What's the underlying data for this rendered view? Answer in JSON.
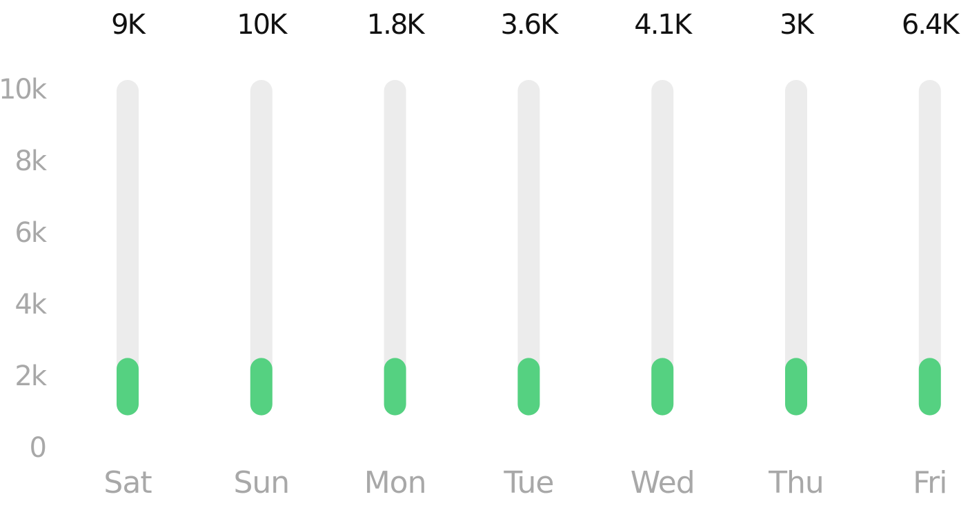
{
  "chart_data": {
    "type": "bar",
    "title": "",
    "xlabel": "",
    "ylabel": "",
    "categories": [
      "Sat",
      "Sun",
      "Mon",
      "Tue",
      "Wed",
      "Thu",
      "Fri"
    ],
    "value_labels": [
      "9K",
      "10K",
      "1.8K",
      "3.6K",
      "4.1K",
      "3K",
      "6.4K"
    ],
    "values": [
      9000,
      10000,
      1800,
      3600,
      4100,
      3000,
      6400
    ],
    "filled_range": [
      950,
      2550
    ],
    "yticks": [
      "0",
      "2k",
      "4k",
      "6k",
      "8k",
      "10k"
    ],
    "ytick_values": [
      0,
      2000,
      4000,
      6000,
      8000,
      10000
    ],
    "ylim": [
      0,
      10000
    ],
    "grid": false,
    "legend": "none",
    "colors": {
      "track": "#ececec",
      "bar": "#55d181",
      "value_text": "#111111",
      "tick_text": "#a8a8a8"
    }
  }
}
